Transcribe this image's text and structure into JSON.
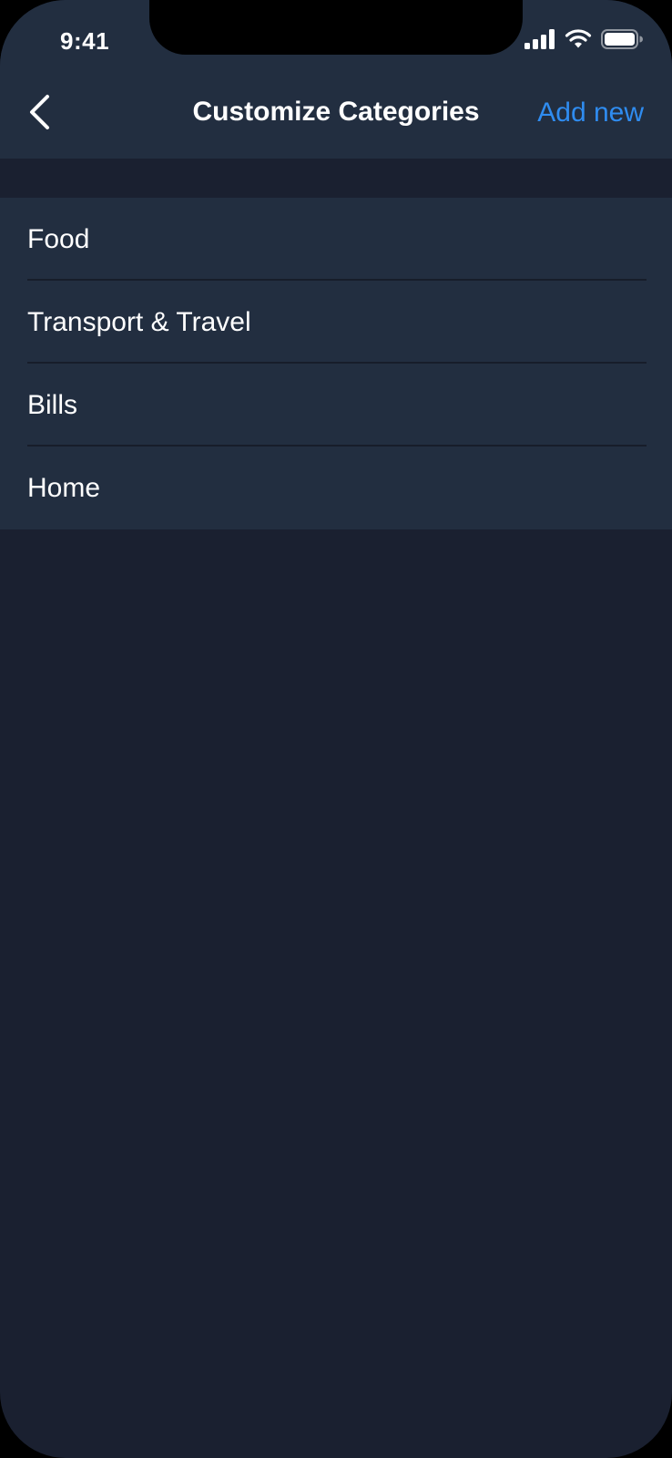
{
  "status_bar": {
    "time": "9:41",
    "icons": [
      "cellular-signal-icon",
      "wifi-icon",
      "battery-icon"
    ]
  },
  "nav": {
    "back_icon": "chevron-left-icon",
    "title": "Customize Categories",
    "action_label": "Add new"
  },
  "categories": [
    {
      "label": "Food"
    },
    {
      "label": "Transport & Travel"
    },
    {
      "label": "Bills"
    },
    {
      "label": "Home"
    }
  ],
  "colors": {
    "background": "#1a2030",
    "surface": "#222e40",
    "accent": "#2f8cf0",
    "text": "#ffffff"
  }
}
